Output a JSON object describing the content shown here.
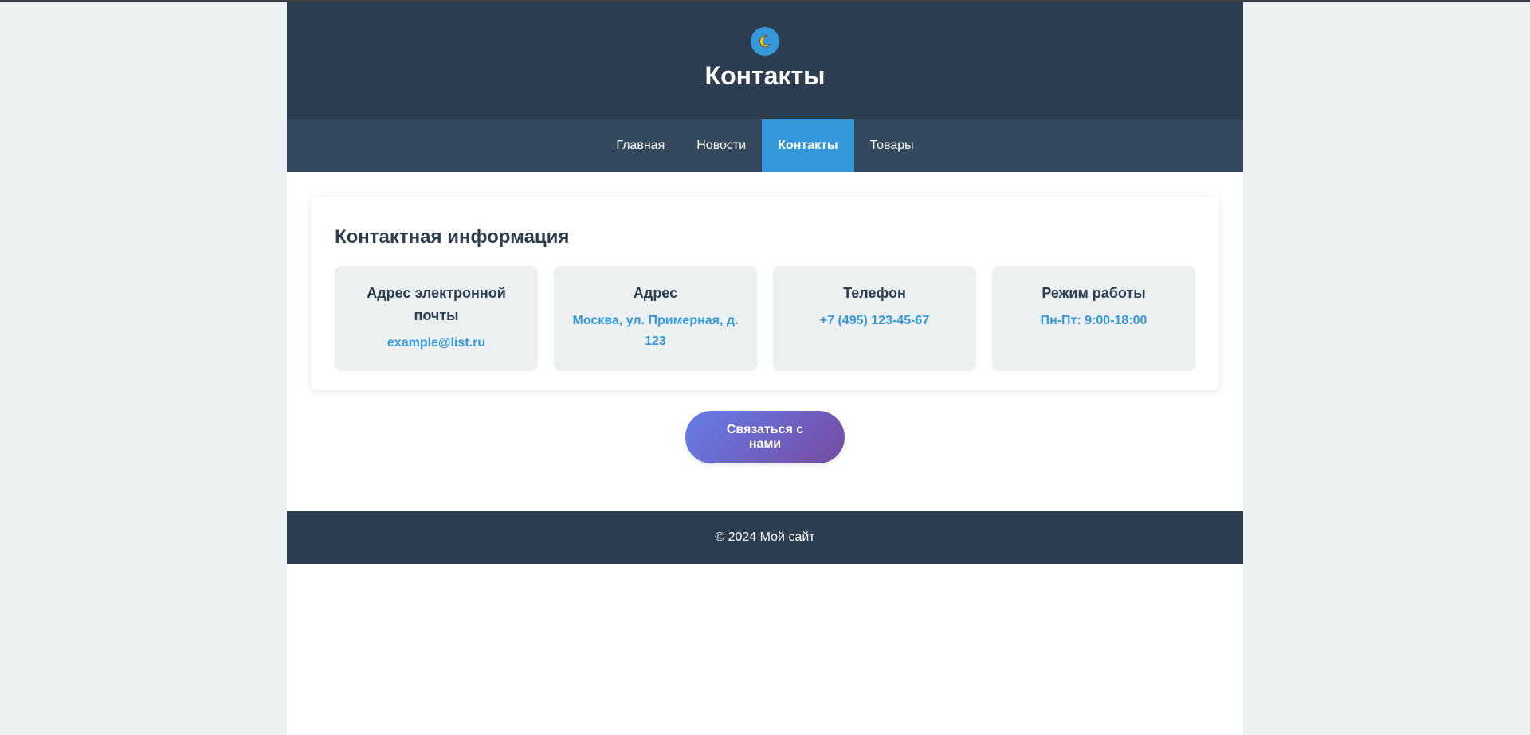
{
  "header": {
    "title": "Контакты",
    "theme_toggle_icon": "moon-icon"
  },
  "nav": {
    "items": [
      {
        "label": "Главная",
        "active": false
      },
      {
        "label": "Новости",
        "active": false
      },
      {
        "label": "Контакты",
        "active": true
      },
      {
        "label": "Товары",
        "active": false
      }
    ]
  },
  "contacts": {
    "title": "Контактная информация",
    "items": [
      {
        "heading": "Адрес электронной почты",
        "value": "example@list.ru"
      },
      {
        "heading": "Адрес",
        "value": "Москва, ул. Примерная, д. 123"
      },
      {
        "heading": "Телефон",
        "value": "+7 (495) 123-45-67"
      },
      {
        "heading": "Режим работы",
        "value": "Пн-Пт: 9:00-18:00"
      }
    ]
  },
  "cta": {
    "label": "Связаться с нами"
  },
  "footer": {
    "text": "© 2024 Мой сайт"
  },
  "colors": {
    "header_bg": "#2c3e50",
    "nav_bg": "#34495e",
    "accent": "#3498db",
    "box_bg": "#ecf0f1",
    "cta_gradient_start": "#667eea",
    "cta_gradient_end": "#764ba2"
  }
}
